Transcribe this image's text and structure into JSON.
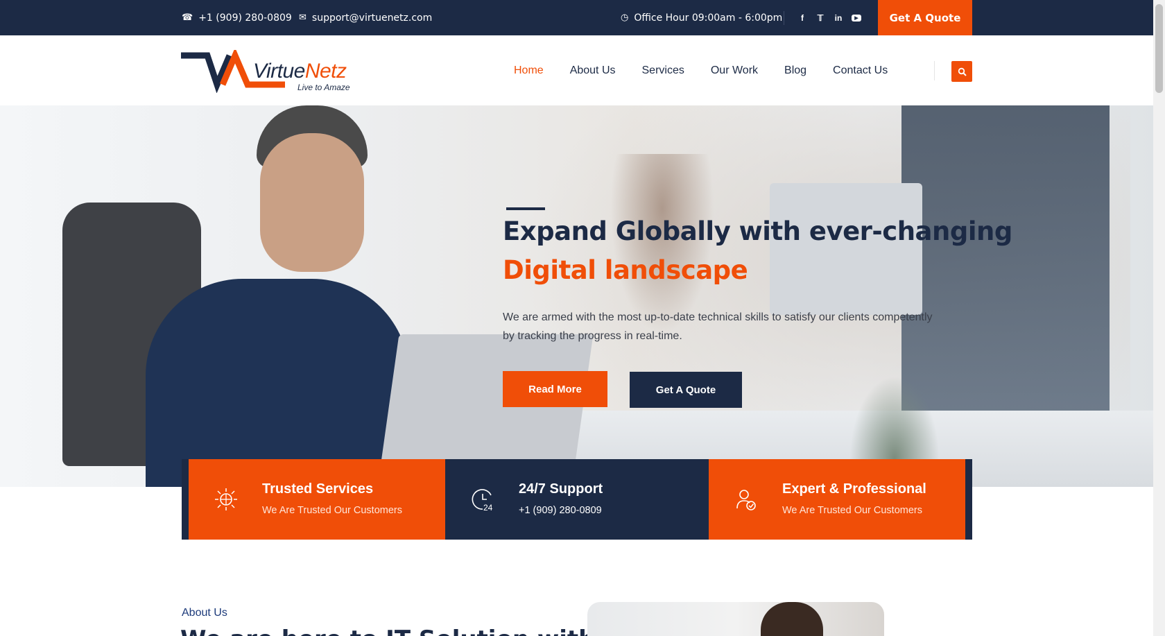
{
  "topbar": {
    "phone": "+1 (909) 280-0809",
    "email": "support@virtuenetz.com",
    "office_hours": "Office Hour 09:00am - 6:00pm",
    "social": [
      "facebook-icon",
      "twitter-icon",
      "linkedin-icon",
      "youtube-icon"
    ],
    "quote_label": "Get A Quote"
  },
  "header": {
    "logo_name_part1": "Virtue",
    "logo_name_part2": "Netz",
    "logo_tagline": "Live to Amaze",
    "nav": [
      {
        "label": "Home",
        "active": true
      },
      {
        "label": "About Us",
        "active": false
      },
      {
        "label": "Services",
        "active": false
      },
      {
        "label": "Our Work",
        "active": false
      },
      {
        "label": "Blog",
        "active": false
      },
      {
        "label": "Contact Us",
        "active": false
      }
    ],
    "search_icon": "search-icon"
  },
  "hero": {
    "title_line1": "Expand Globally with ever-changing",
    "title_line2": "Digital landscape",
    "description": "We are armed with the most up-to-date technical skills to satisfy our clients competently by tracking the progress in real-time.",
    "read_more_label": "Read More",
    "quote_label": "Get A Quote"
  },
  "features": [
    {
      "title": "Trusted Services",
      "subtitle": "We Are Trusted Our Customers",
      "icon": "globe-network-icon"
    },
    {
      "title": "24/7 Support",
      "subtitle": "+1 (909) 280-0809",
      "icon": "clock-24-icon"
    },
    {
      "title": "Expert & Professional",
      "subtitle": "We Are Trusted Our Customers",
      "icon": "expert-person-icon"
    }
  ],
  "about": {
    "label": "About Us",
    "heading": "We are here to IT Solution with"
  },
  "colors": {
    "navy": "#1c2a45",
    "orange": "#f04e08"
  }
}
